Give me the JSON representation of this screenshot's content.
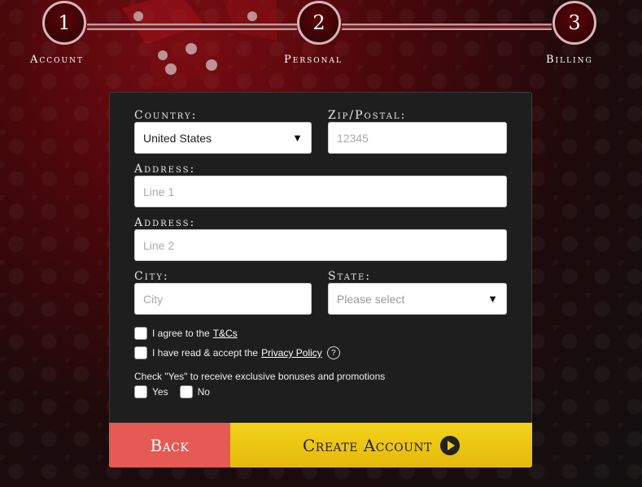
{
  "steps": [
    {
      "number": "1",
      "label": "Account"
    },
    {
      "number": "2",
      "label": "Personal"
    },
    {
      "number": "3",
      "label": "Billing"
    }
  ],
  "form": {
    "country_label": "Country:",
    "country_value": "United States",
    "zip_label": "Zip/Postal:",
    "zip_placeholder": "12345",
    "address1_label": "Address:",
    "address1_placeholder": "Line 1",
    "address2_label": "Address:",
    "address2_placeholder": "Line 2",
    "city_label": "City:",
    "city_placeholder": "City",
    "state_label": "State:",
    "state_placeholder": "Please select",
    "tc_text": "I agree to the",
    "tc_link": "T&Cs",
    "privacy_text": "I have read & accept the",
    "privacy_link": "Privacy Policy",
    "help_glyph": "?",
    "promo_text": "Check \"Yes\" to receive exclusive bonuses and promotions",
    "yes_label": "Yes",
    "no_label": "No"
  },
  "buttons": {
    "back": "Back",
    "create": "Create Account"
  },
  "icons": {
    "dropdown": "chevron-down-icon",
    "help": "help-icon",
    "play": "play-icon"
  }
}
